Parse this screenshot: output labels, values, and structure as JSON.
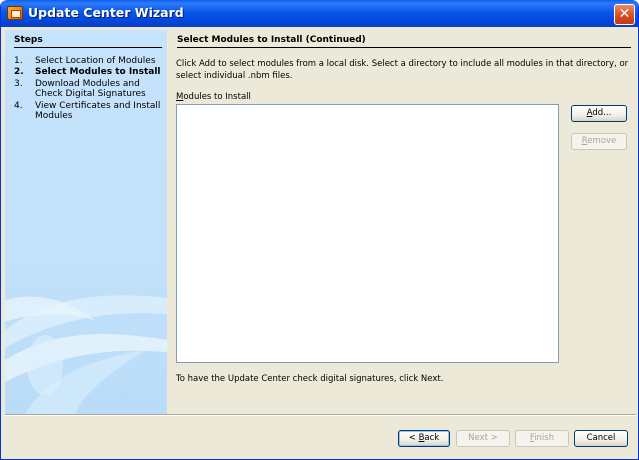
{
  "window": {
    "title": "Update Center Wizard",
    "close_glyph": "✕",
    "icon": "app-icon"
  },
  "steps": {
    "title": "Steps",
    "items": [
      {
        "num": "1.",
        "label": "Select Location of Modules",
        "current": false
      },
      {
        "num": "2.",
        "label": "Select Modules to Install",
        "current": true
      },
      {
        "num": "3.",
        "label": "Download Modules and Check Digital Signatures",
        "current": false
      },
      {
        "num": "4.",
        "label": "View Certificates and Install Modules",
        "current": false
      }
    ]
  },
  "panel": {
    "title": "Select Modules to Install (Continued)",
    "description": "Click Add to select modules from a local disk. Select a directory to include all modules in that directory, or select individual .nbm files.",
    "list_label_mnemonic": "M",
    "list_label_rest": "odules to Install",
    "footer_note": "To have the Update Center check digital signatures, click Next."
  },
  "buttons": {
    "add": {
      "mnemonic": "A",
      "rest": "dd...",
      "enabled": true
    },
    "remove": {
      "mnemonic": "R",
      "rest": "emove",
      "enabled": false
    },
    "back": {
      "prefix": "< ",
      "mnemonic": "B",
      "rest": "ack",
      "enabled": true
    },
    "next": {
      "label": "Next >",
      "enabled": false
    },
    "finish": {
      "mnemonic": "F",
      "rest": "inish",
      "enabled": false
    },
    "cancel": {
      "label": "Cancel",
      "enabled": true
    }
  },
  "colors": {
    "titlebar": "#0757ea",
    "left_panel": "#c5e3fb",
    "dialog_bg": "#ece9d8",
    "list_border": "#7f9db9"
  }
}
